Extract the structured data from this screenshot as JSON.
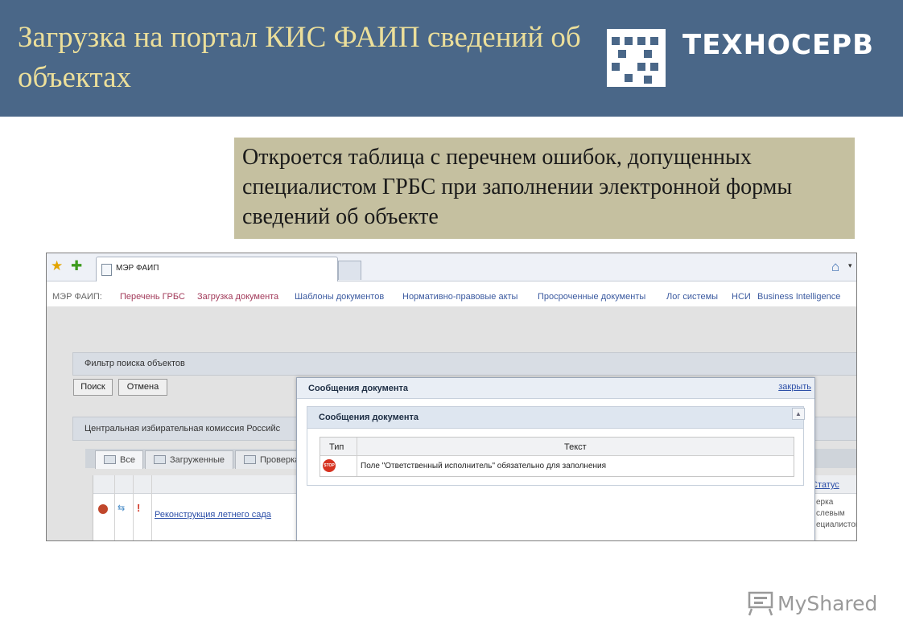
{
  "slide": {
    "title": "Загрузка на портал КИС ФАИП сведений об объектах",
    "logo_text": "ТЕХНОСЕРВ",
    "callout": "Откроется таблица с перечнем ошибок, допущенных специалистом ГРБС при заполнении электронной формы сведений об объекте",
    "watermark": "MyShared"
  },
  "browser": {
    "tab_title": "МЭР ФАИП",
    "icons": [
      "favorites-star-icon",
      "add-favorite-icon",
      "home-icon"
    ]
  },
  "app": {
    "nav_prefix": "МЭР ФАИП:",
    "nav_items": [
      "Перечень ГРБС",
      "Загрузка документа",
      "Шаблоны документов",
      "Нормативно-правовые акты",
      "Просроченные документы",
      "Лог системы",
      "НСИ",
      "Business Intelligence"
    ],
    "filter_title": "Фильтр поиска объектов",
    "search_button": "Поиск",
    "cancel_button": "Отмена",
    "org_title": "Центральная избирательная комиссия Российс",
    "tabs": [
      "Все",
      "Загруженные",
      "Проверка"
    ],
    "row_link": "Реконструкция летнего сада",
    "status_header": "Статус",
    "status_text": "ерка слевым ециалистом"
  },
  "modal": {
    "title": "Сообщения документа",
    "close_label": "закрыть",
    "inner_title": "Сообщения документа",
    "columns": [
      "Тип",
      "Текст"
    ],
    "rows": [
      {
        "type_icon": "stop-icon",
        "type_label": "STOP",
        "text": "Поле \"Ответственный исполнитель\" обязательно для заполнения"
      }
    ]
  },
  "colors": {
    "header_bg": "#4a6788",
    "title": "#ecdf9a",
    "callout_bg": "#c5c0a0",
    "link": "#3b5aa0"
  }
}
